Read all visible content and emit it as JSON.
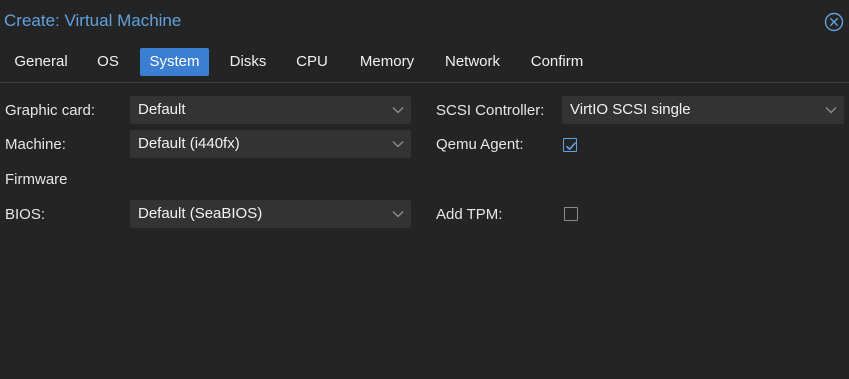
{
  "window": {
    "title": "Create: Virtual Machine",
    "close_icon": "close-circle-icon"
  },
  "tabs": [
    {
      "label": "General",
      "active": false
    },
    {
      "label": "OS",
      "active": false
    },
    {
      "label": "System",
      "active": true
    },
    {
      "label": "Disks",
      "active": false
    },
    {
      "label": "CPU",
      "active": false
    },
    {
      "label": "Memory",
      "active": false
    },
    {
      "label": "Network",
      "active": false
    },
    {
      "label": "Confirm",
      "active": false
    }
  ],
  "form": {
    "graphic_card": {
      "label": "Graphic card:",
      "value": "Default"
    },
    "machine": {
      "label": "Machine:",
      "value": "Default (i440fx)"
    },
    "firmware_heading": "Firmware",
    "bios": {
      "label": "BIOS:",
      "value": "Default (SeaBIOS)"
    },
    "scsi_controller": {
      "label": "SCSI Controller:",
      "value": "VirtIO SCSI single"
    },
    "qemu_agent": {
      "label": "Qemu Agent:",
      "checked": true
    },
    "add_tpm": {
      "label": "Add TPM:",
      "checked": false
    }
  },
  "colors": {
    "accent": "#3a7fd1",
    "title": "#5fa2dd",
    "background": "#242424",
    "field": "#333333"
  }
}
